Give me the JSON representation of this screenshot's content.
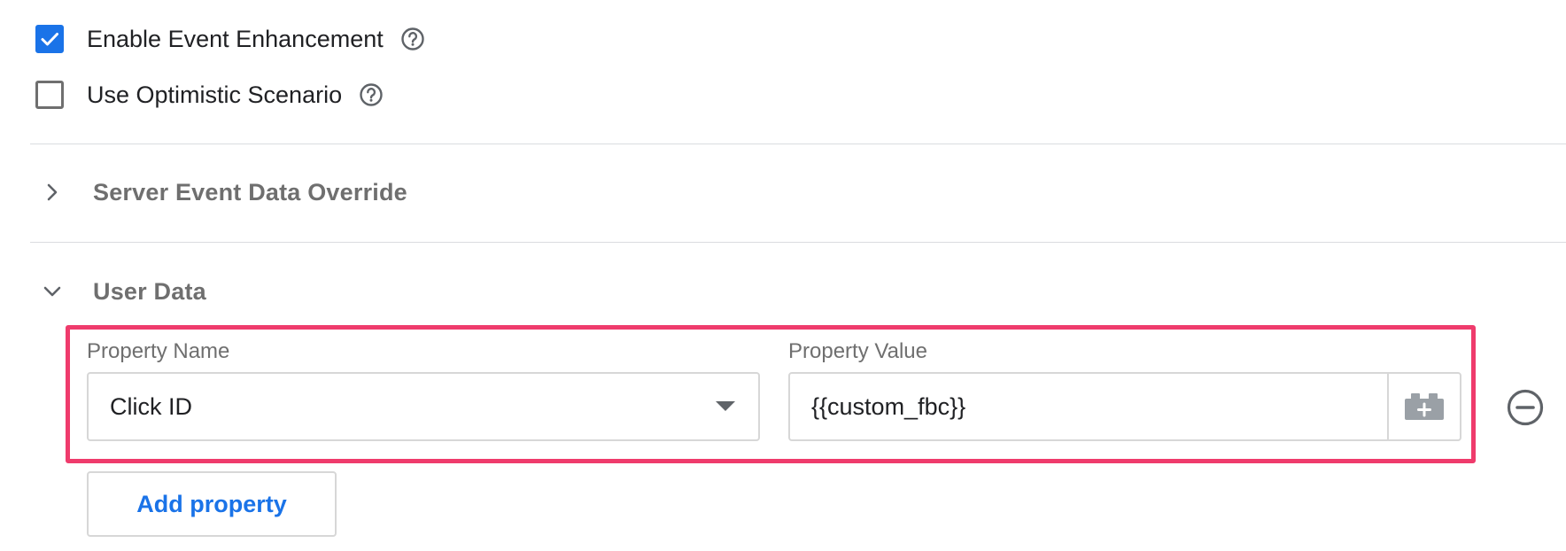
{
  "checkboxes": [
    {
      "label": "Enable Event Enhancement",
      "checked": true,
      "icon": "help-icon"
    },
    {
      "label": "Use Optimistic Scenario",
      "checked": false,
      "icon": "help-icon"
    }
  ],
  "sections": {
    "server_event": {
      "title": "Server Event Data Override",
      "expanded": false,
      "icon": "chevron-right-icon"
    },
    "user_data": {
      "title": "User Data",
      "expanded": true,
      "icon": "chevron-down-icon"
    }
  },
  "property_row": {
    "name_label": "Property Name",
    "name_value": "Click ID",
    "value_label": "Property Value",
    "value_value": "{{custom_fbc}}",
    "variable_icon": "variable-brick-icon",
    "remove_icon": "remove-circle-icon"
  },
  "add_property_label": "Add property",
  "colors": {
    "accent": "#1a73e8",
    "highlight": "#ef3b6c",
    "muted_text": "#6f6f6f",
    "border": "#d7d7d7"
  }
}
